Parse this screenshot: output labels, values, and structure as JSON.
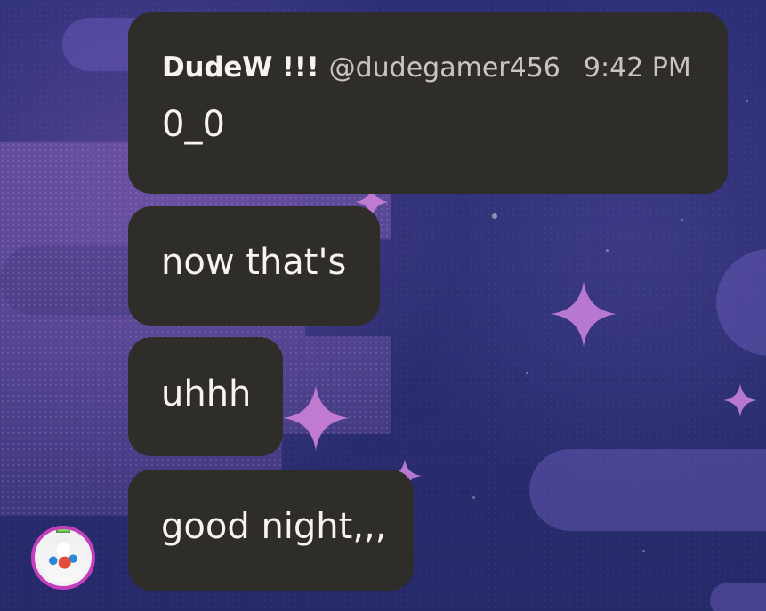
{
  "messages": [
    {
      "display_name": "DudeW !!!",
      "handle": "@dudegamer456",
      "time": "9:42 PM",
      "text": "0_0"
    },
    {
      "text": "now that's"
    },
    {
      "text": "uhhh"
    },
    {
      "text": "good night,,,"
    }
  ],
  "colors": {
    "background": "#2c2f77",
    "bubble": "#2f2d2a",
    "text_primary": "#f7f4ef",
    "text_secondary": "#c9c4be",
    "avatar_border": "#c33fbe"
  },
  "icons": {
    "avatar": "user-avatar-icon"
  }
}
